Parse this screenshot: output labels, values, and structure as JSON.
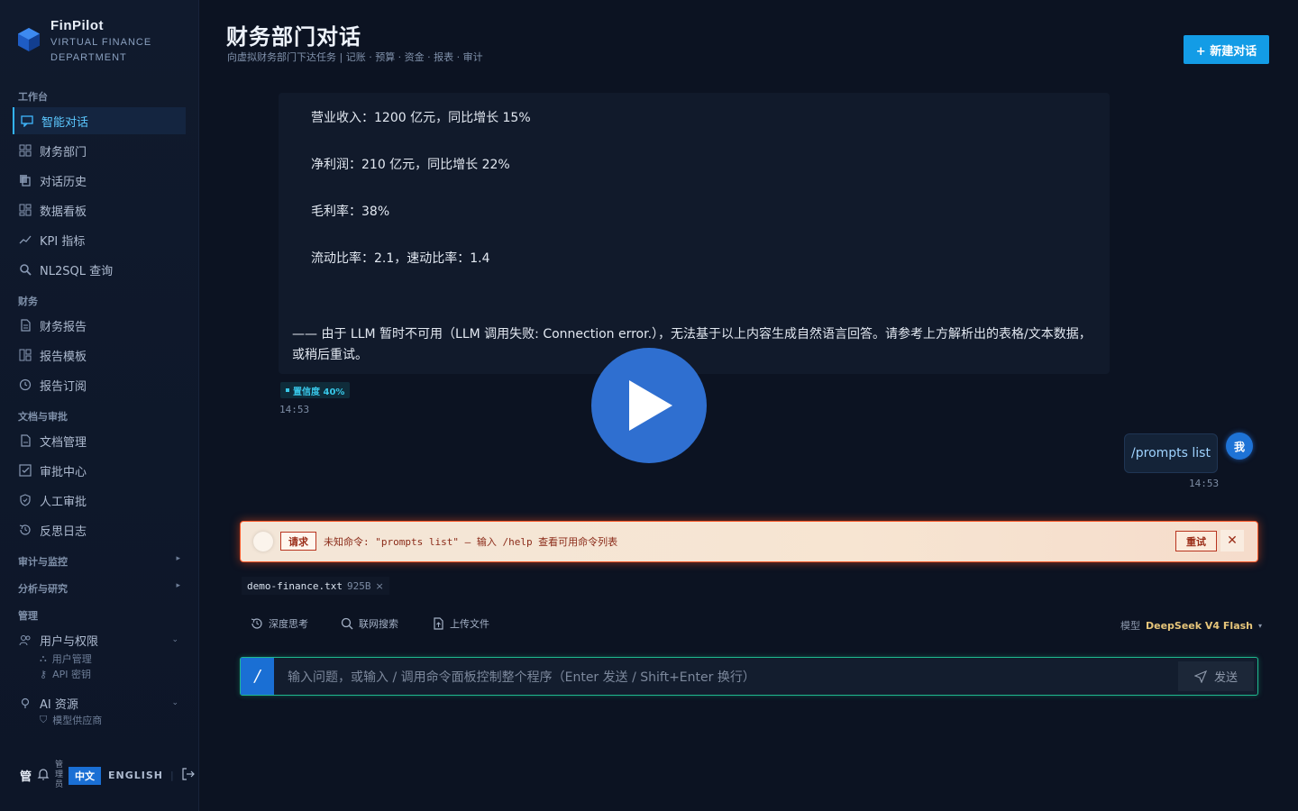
{
  "brand": {
    "name": "FinPilot",
    "subtitle_line1": "VIRTUAL FINANCE",
    "subtitle_line2": "DEPARTMENT"
  },
  "sidebar": {
    "groups": [
      {
        "label": "工作台"
      },
      {
        "label": "财务"
      },
      {
        "label": "文档与审批"
      },
      {
        "label": "审计与监控"
      },
      {
        "label": "分析与研究"
      },
      {
        "label": "管理"
      }
    ],
    "items": [
      {
        "label": "智能对话",
        "icon": "chat-icon"
      },
      {
        "label": "财务部门",
        "icon": "grid-icon"
      },
      {
        "label": "对话历史",
        "icon": "copy-icon"
      },
      {
        "label": "数据看板",
        "icon": "dashboard-icon"
      },
      {
        "label": "KPI 指标",
        "icon": "trend-icon"
      },
      {
        "label": "NL2SQL 查询",
        "icon": "search-icon"
      },
      {
        "label": "财务报告",
        "icon": "document-icon"
      },
      {
        "label": "报告模板",
        "icon": "template-icon"
      },
      {
        "label": "报告订阅",
        "icon": "clock-icon"
      },
      {
        "label": "文档管理",
        "icon": "file-icon"
      },
      {
        "label": "审批中心",
        "icon": "check-square-icon"
      },
      {
        "label": "人工审批",
        "icon": "shield-icon"
      },
      {
        "label": "反思日志",
        "icon": "history-icon"
      },
      {
        "label": "用户与权限",
        "icon": "users-icon"
      },
      {
        "label": "AI 资源",
        "icon": "ai-icon"
      }
    ],
    "sub_items": [
      {
        "label": "用户管理"
      },
      {
        "label": "API 密钥"
      },
      {
        "label": "模型供应商"
      }
    ],
    "footer": {
      "admin_text": "管",
      "admin_small": "管理员",
      "lang_zh": "中文",
      "lang_en": "ENGLISH"
    }
  },
  "header": {
    "title": "财务部门对话",
    "subtitle": "向虚拟财务部门下达任务 | 记账 · 预算 · 资金 · 报表 · 审计",
    "new_chat_label": "+ 新建对话"
  },
  "assistant_message": {
    "lines": [
      "营业收入：1200 亿元，同比增长 15%",
      "净利润：210 亿元，同比增长 22%",
      "毛利率：38%",
      "流动比率：2.1，速动比率：1.4"
    ],
    "note": "—— 由于 LLM 暂时不可用（LLM 调用失败: Connection error.），无法基于以上内容生成自然语言回答。请参考上方解析出的表格/文本数据，或稍后重试。",
    "confidence_label": "置信度 40%",
    "confidence": 0.4,
    "time": "14:53"
  },
  "user_message": {
    "text": "/prompts list",
    "avatar": "我",
    "time": "14:53"
  },
  "error_bar": {
    "tag": "请求",
    "text": "未知命令: \"prompts list\" — 输入 /help 查看可用命令列表",
    "retry_label": "重试"
  },
  "attachment": {
    "name": "demo-finance.txt",
    "size": "925B"
  },
  "toolbar": {
    "deep_think": "深度思考",
    "web_search": "联网搜索",
    "upload": "上传文件",
    "model_label": "模型",
    "model_name": "DeepSeek V4 Flash"
  },
  "composer": {
    "slash": "/",
    "placeholder": "输入问题，或输入 / 调用命令面板控制整个程序（Enter 发送 / Shift+Enter 换行）",
    "send_label": "发送"
  },
  "colors": {
    "accent": "#139ce6",
    "active": "#33b4ff",
    "error": "#ff5a2a",
    "input_border": "#1fb98f"
  }
}
